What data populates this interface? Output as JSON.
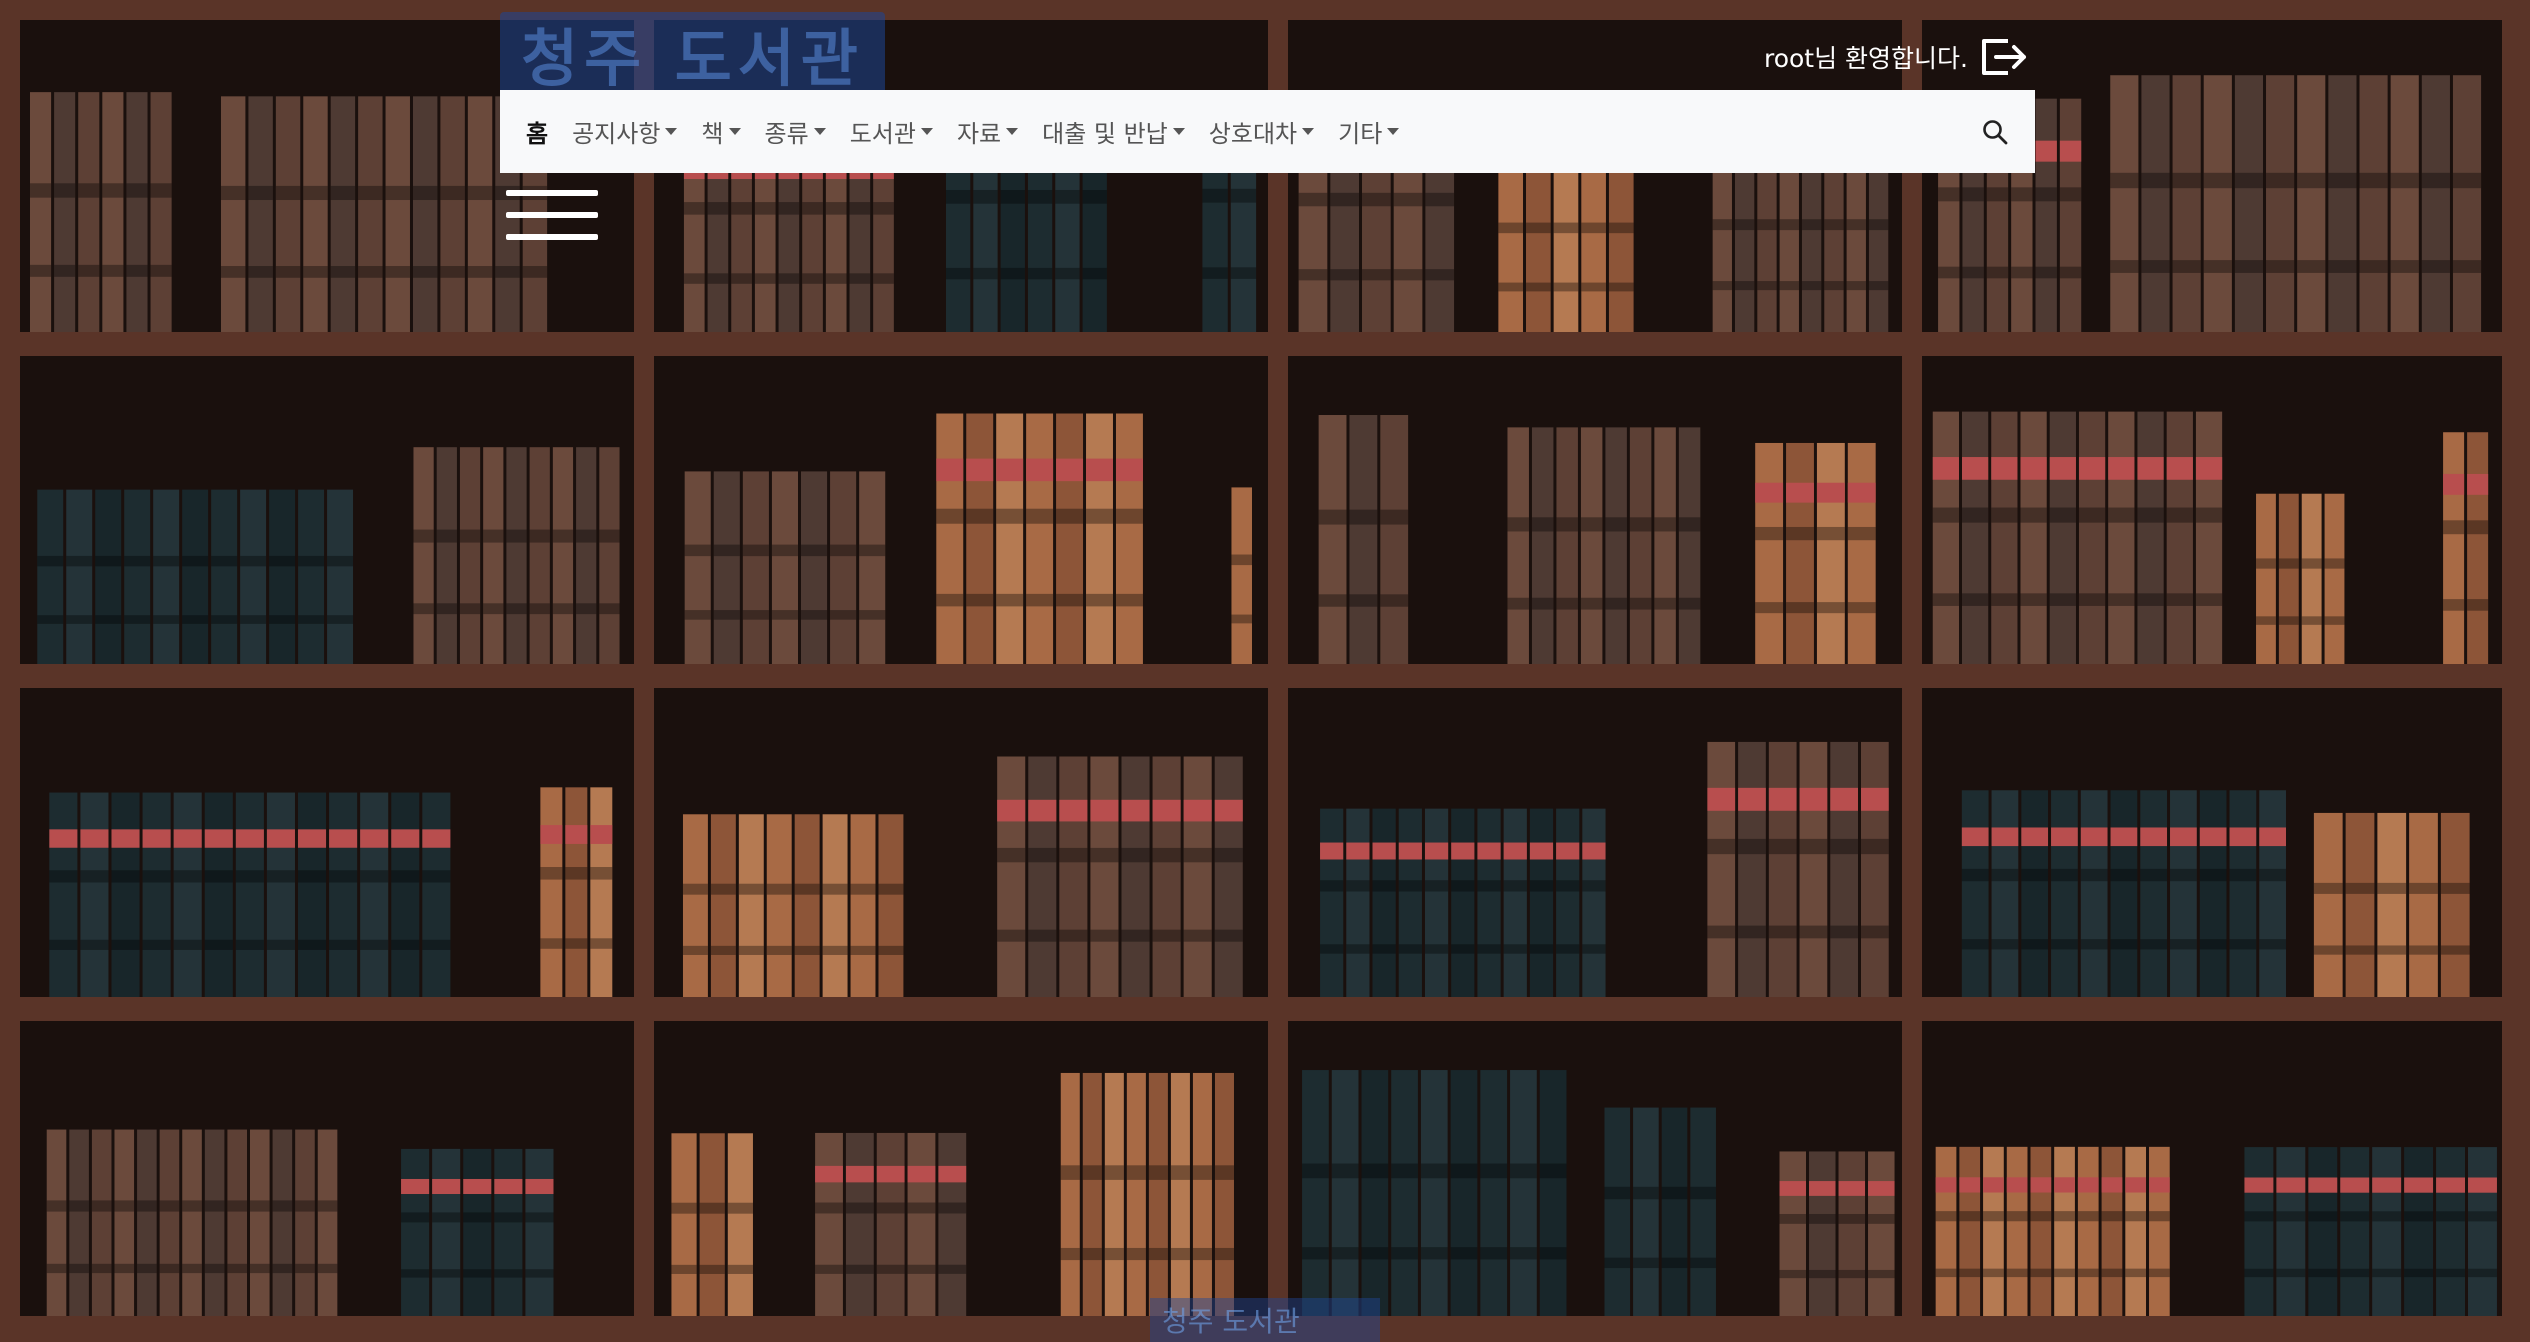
{
  "header": {
    "logo_text": "청주 도서관",
    "welcome_text": "root님 환영합니다.",
    "logout_icon": "logout-icon"
  },
  "nav": {
    "items": [
      {
        "label": "홈",
        "dropdown": false,
        "active": true
      },
      {
        "label": "공지사항",
        "dropdown": true
      },
      {
        "label": "책",
        "dropdown": true
      },
      {
        "label": "종류",
        "dropdown": true
      },
      {
        "label": "도서관",
        "dropdown": true
      },
      {
        "label": "자료",
        "dropdown": true
      },
      {
        "label": "대출 및 반납",
        "dropdown": true
      },
      {
        "label": "상호대차",
        "dropdown": true
      },
      {
        "label": "기타",
        "dropdown": true
      }
    ],
    "search_icon": "search-icon",
    "background": "#f8f9fa"
  },
  "sidebar_toggle": {
    "icon": "hamburger-icon"
  },
  "footer": {
    "mark_text": "청주 도서관"
  },
  "colors": {
    "wood": "#5a3428",
    "shelf_back": "#1a100d",
    "book_tan": "#a86a45",
    "book_teal": "#1d2c30",
    "book_red": "#b84e4e"
  }
}
